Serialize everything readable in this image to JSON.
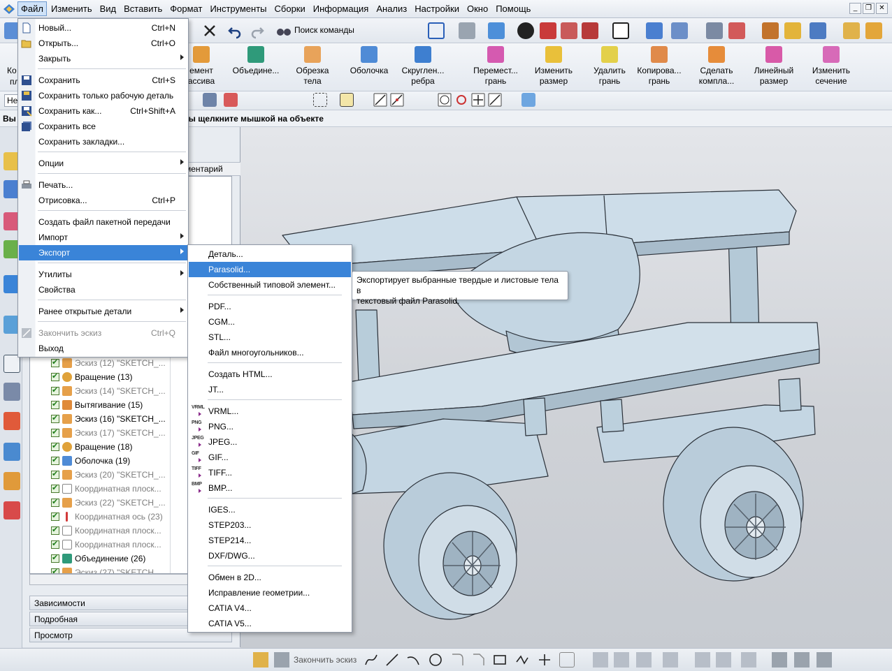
{
  "menubar": {
    "items": [
      "Файл",
      "Изменить",
      "Вид",
      "Вставить",
      "Формат",
      "Инструменты",
      "Сборки",
      "Информация",
      "Анализ",
      "Настройки",
      "Окно",
      "Помощь"
    ]
  },
  "toolbar1": {
    "search_label": "Поиск команды"
  },
  "ribbon": {
    "left_stub_lines": [
      "Ко",
      "пл"
    ],
    "buttons": [
      {
        "line1": "емент",
        "line2": "ассива"
      },
      {
        "line1": "Объедине...",
        "line2": ""
      },
      {
        "line1": "Обрезка",
        "line2": "тела"
      },
      {
        "line1": "Оболочка",
        "line2": ""
      },
      {
        "line1": "Скруглен...",
        "line2": "ребра"
      },
      {
        "line1": "Перемест...",
        "line2": "грань"
      },
      {
        "line1": "Изменить",
        "line2": "размер"
      },
      {
        "line1": "Удалить",
        "line2": "грань"
      },
      {
        "line1": "Копирова...",
        "line2": "грань"
      },
      {
        "line1": "Сделать",
        "line2": "компла..."
      },
      {
        "line1": "Линейный",
        "line2": "размер"
      },
      {
        "line1": "Изменить",
        "line2": "сечение"
      }
    ]
  },
  "toolbar3": {
    "filter_value": "Не"
  },
  "cuebar": {
    "left_text": "Вы",
    "text": "ды щелкните мышкой на объекте"
  },
  "navigator": {
    "column_header": "ментарий",
    "rows": [
      {
        "label": "Эскиз (12) \"SKETCH_...",
        "disabled": true
      },
      {
        "label": "Вращение (13)",
        "disabled": false
      },
      {
        "label": "Эскиз (14) \"SKETCH_...",
        "disabled": true
      },
      {
        "label": "Вытягивание (15)",
        "disabled": false
      },
      {
        "label": "Эскиз (16) \"SKETCH_...",
        "disabled": false
      },
      {
        "label": "Эскиз (17) \"SKETCH_...",
        "disabled": true
      },
      {
        "label": "Вращение (18)",
        "disabled": false
      },
      {
        "label": "Оболочка (19)",
        "disabled": false
      },
      {
        "label": "Эскиз (20) \"SKETCH_...",
        "disabled": true
      },
      {
        "label": "Координатная плоск...",
        "disabled": true
      },
      {
        "label": "Эскиз (22) \"SKETCH_...",
        "disabled": true
      },
      {
        "label": "Координатная ось (23)",
        "disabled": true
      },
      {
        "label": "Координатная плоск...",
        "disabled": true
      },
      {
        "label": "Координатная плоск...",
        "disabled": true
      },
      {
        "label": "Объединение (26)",
        "disabled": false
      },
      {
        "label": "Эскиз (27) \"SKETCH...",
        "disabled": true
      }
    ],
    "sections": [
      "Зависимости",
      "Подробная",
      "Просмотр"
    ]
  },
  "file_menu": {
    "items": [
      {
        "label": "Новый...",
        "shortcut": "Ctrl+N",
        "icon": "new-file-icon"
      },
      {
        "label": "Открыть...",
        "shortcut": "Ctrl+O",
        "icon": "open-folder-icon"
      },
      {
        "label": "Закрыть",
        "submenu": true
      },
      {
        "label": "Сохранить",
        "shortcut": "Ctrl+S",
        "icon": "save-icon"
      },
      {
        "label": "Сохранить только рабочую деталь",
        "icon": "save-work-part-icon"
      },
      {
        "label": "Сохранить как...",
        "shortcut": "Ctrl+Shift+A",
        "icon": "save-as-icon"
      },
      {
        "label": "Сохранить все",
        "icon": "save-all-icon"
      },
      {
        "label": "Сохранить закладки..."
      },
      {
        "label": "Опции",
        "submenu": true
      },
      {
        "label": "Печать...",
        "icon": "printer-icon"
      },
      {
        "label": "Отрисовка...",
        "shortcut": "Ctrl+P"
      },
      {
        "label": "Создать файл пакетной передачи"
      },
      {
        "label": "Импорт",
        "submenu": true
      },
      {
        "label": "Экспорт",
        "submenu": true,
        "highlighted": true
      },
      {
        "label": "Утилиты",
        "submenu": true
      },
      {
        "label": "Свойства"
      },
      {
        "label": "Ранее открытые детали",
        "submenu": true
      },
      {
        "label": "Закончить эскиз",
        "shortcut": "Ctrl+Q",
        "disabled": true,
        "icon": "finish-sketch-icon"
      },
      {
        "label": "Выход"
      }
    ]
  },
  "export_menu": {
    "items": [
      {
        "label": "Деталь..."
      },
      {
        "label": "Parasolid...",
        "highlighted": true
      },
      {
        "label": "Собственный типовой элемент..."
      },
      {
        "label": "PDF..."
      },
      {
        "label": "CGM..."
      },
      {
        "label": "STL..."
      },
      {
        "label": "Файл многоугольников..."
      },
      {
        "label": "Создать HTML..."
      },
      {
        "label": "JT..."
      },
      {
        "label": "VRML...",
        "badge": "VRML"
      },
      {
        "label": "PNG...",
        "badge": "PNG"
      },
      {
        "label": "JPEG...",
        "badge": "JPEG"
      },
      {
        "label": "GIF...",
        "badge": "GIF"
      },
      {
        "label": "TIFF...",
        "badge": "TIFF"
      },
      {
        "label": "BMP...",
        "badge": "BMP"
      },
      {
        "label": "IGES..."
      },
      {
        "label": "STEP203..."
      },
      {
        "label": "STEP214..."
      },
      {
        "label": "DXF/DWG..."
      },
      {
        "label": "Обмен в 2D..."
      },
      {
        "label": "Исправление геометрии..."
      },
      {
        "label": "CATIA V4..."
      },
      {
        "label": "CATIA V5..."
      }
    ]
  },
  "tooltip": {
    "line1": "Экспортирует выбранные твердые и листовые тела в",
    "line2": "текстовый файл Parasolid."
  },
  "bottombar": {
    "finish_sketch_label": "Закончить эскиз"
  },
  "colors": {
    "menu_highlight": "#3a84d8",
    "model_fill": "#c5d8e6",
    "model_edge": "#2a3038"
  }
}
